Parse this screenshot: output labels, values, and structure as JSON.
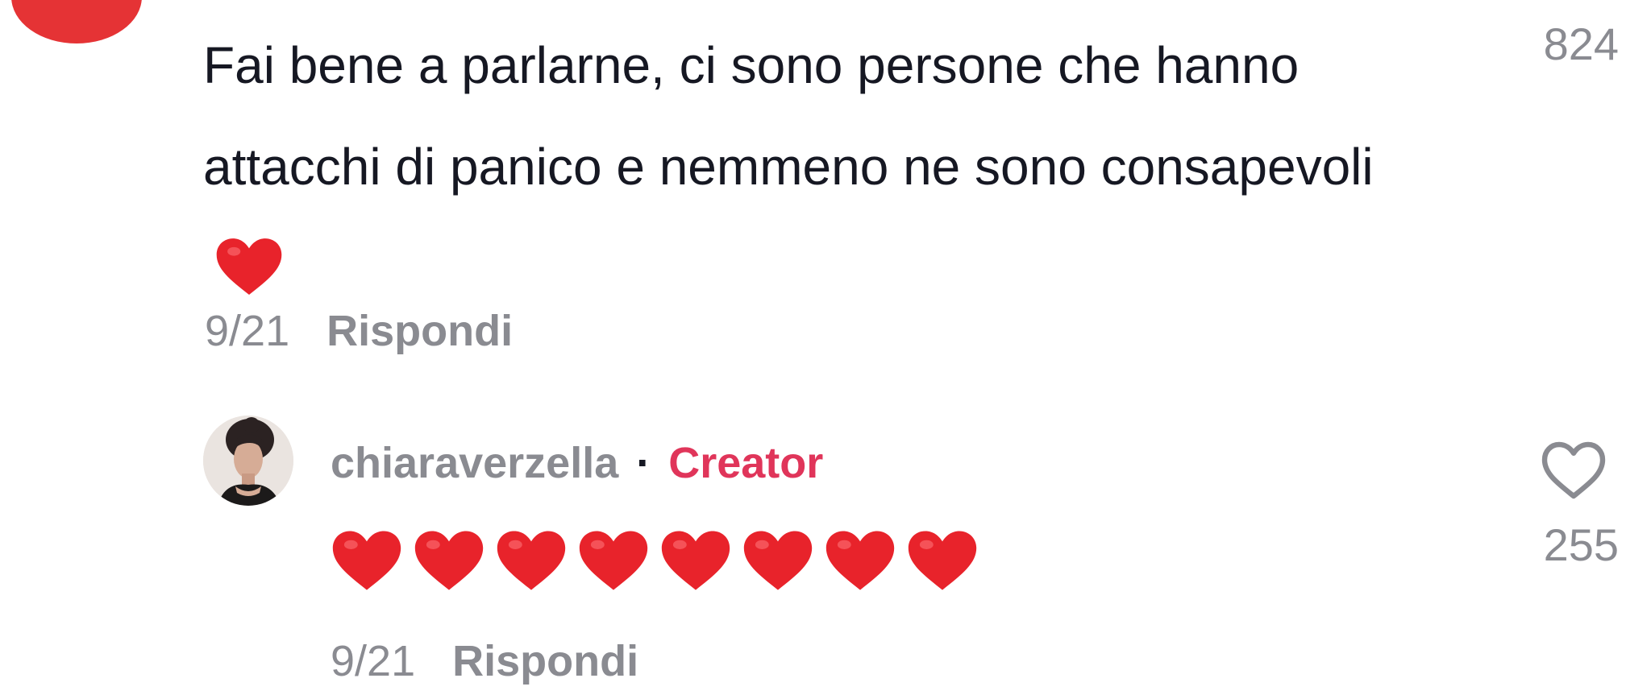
{
  "comment": {
    "text": "Fai bene a parlarne, ci sono persone che hanno attacchi di panico e nemmeno ne sono consapevoli",
    "like_count": "824",
    "date": "9/21",
    "reply_label": "Rispondi",
    "emoji": "red-heart"
  },
  "reply": {
    "username": "chiaraverzella",
    "separator": "·",
    "badge": "Creator",
    "heart_count": 8,
    "like_count": "255",
    "date": "9/21",
    "reply_label": "Rispondi"
  },
  "colors": {
    "text_primary": "#161823",
    "text_secondary": "#8a8b91",
    "creator_accent": "#e0355a",
    "heart": "#e8232b",
    "avatar_red": "#e53335"
  },
  "icons": {
    "like": "heart-outline-icon",
    "emoji": "red-heart-emoji-icon"
  }
}
